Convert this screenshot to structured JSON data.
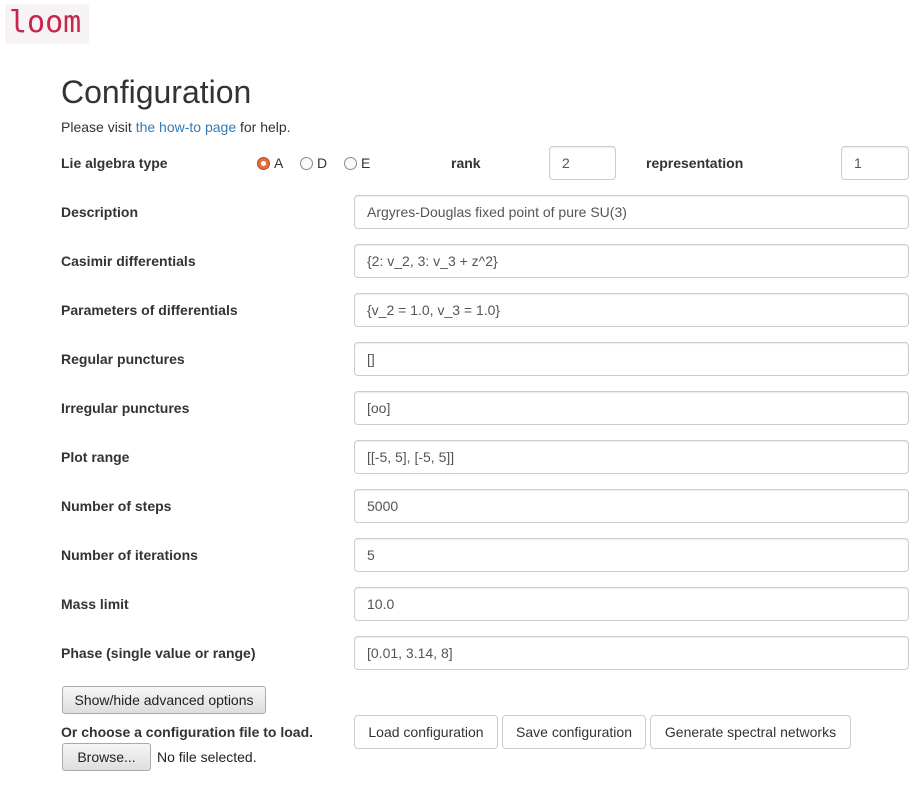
{
  "logo": "loom",
  "title": "Configuration",
  "help": {
    "prefix": "Please visit ",
    "link": "the how-to page",
    "suffix": " for help."
  },
  "lie_algebra": {
    "label": "Lie algebra type",
    "options": [
      "A",
      "D",
      "E"
    ],
    "selected": "A"
  },
  "rank": {
    "label": "rank",
    "value": "2"
  },
  "representation": {
    "label": "representation",
    "value": "1"
  },
  "fields": [
    {
      "label": "Description",
      "value": "Argyres-Douglas fixed point of pure SU(3)"
    },
    {
      "label": "Casimir differentials",
      "value": "{2: v_2, 3: v_3 + z^2}"
    },
    {
      "label": "Parameters of differentials",
      "value": "{v_2 = 1.0, v_3 = 1.0}"
    },
    {
      "label": "Regular punctures",
      "value": "[]"
    },
    {
      "label": "Irregular punctures",
      "value": "[oo]"
    },
    {
      "label": "Plot range",
      "value": "[[-5, 5], [-5, 5]]"
    },
    {
      "label": "Number of steps",
      "value": "5000"
    },
    {
      "label": "Number of iterations",
      "value": "5"
    },
    {
      "label": "Mass limit",
      "value": "10.0"
    },
    {
      "label": "Phase (single value or range)",
      "value": "[0.01, 3.14, 8]"
    }
  ],
  "advanced_button": "Show/hide advanced options",
  "load_file_label": "Or choose a configuration file to load.",
  "browse_button": "Browse...",
  "file_status": "No file selected.",
  "actions": {
    "load": "Load configuration",
    "save": "Save configuration",
    "generate": "Generate spectral networks"
  }
}
